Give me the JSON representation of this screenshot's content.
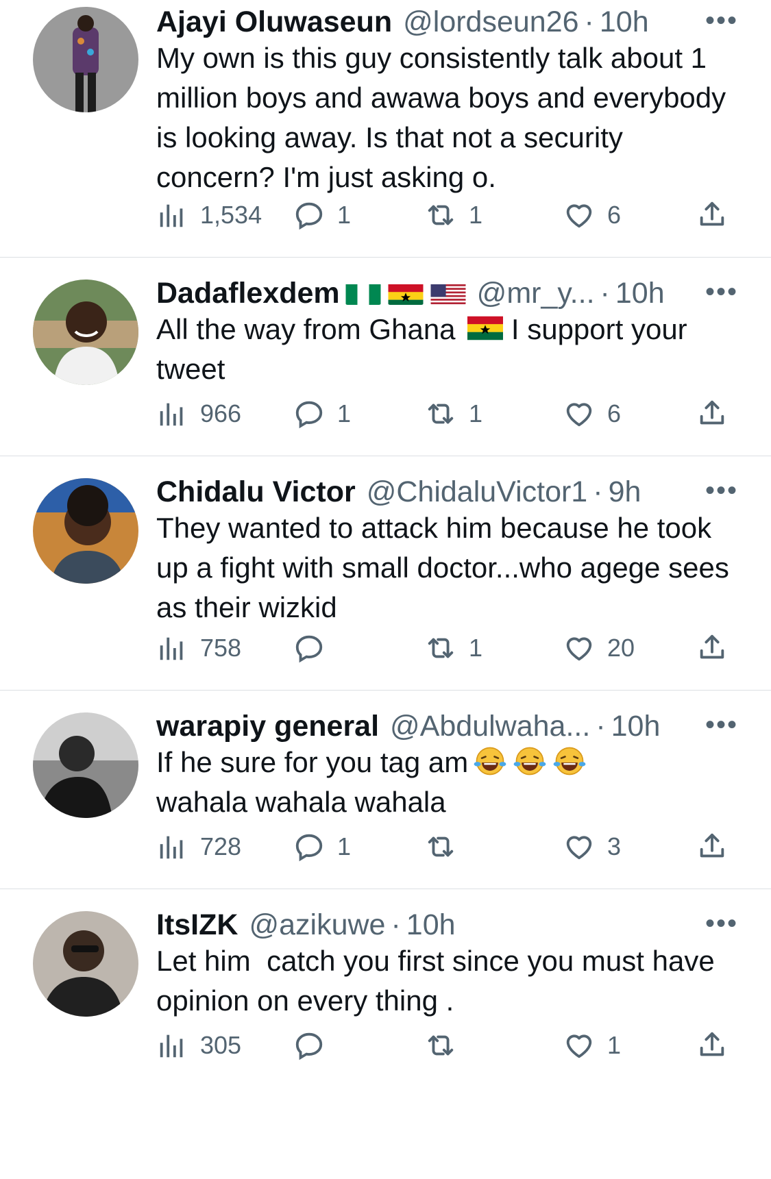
{
  "tweets": [
    {
      "name": "Ajayi Oluwaseun",
      "handle": "@lordseun26",
      "separator": "·",
      "time": "10h",
      "text": "My own is this guy consistently talk about 1 million boys and awawa boys and everybody is looking away. Is that not a security concern? I'm just asking o.",
      "views": "1,534",
      "replies": "1",
      "retweets": "1",
      "likes": "6"
    },
    {
      "name": "Dadaflexdem",
      "handle": "@mr_y...",
      "separator": "·",
      "time": "10h",
      "text_before_flag": "All the way from Ghana ",
      "text_after_flag": " I support your tweet",
      "views": "966",
      "replies": "1",
      "retweets": "1",
      "likes": "6"
    },
    {
      "name": "Chidalu Victor",
      "handle": "@ChidaluVictor1",
      "separator": "·",
      "time": "9h",
      "text": "They wanted to attack him because he took up a fight with small doctor...who agege sees as their wizkid",
      "views": "758",
      "replies": "",
      "retweets": "1",
      "likes": "20"
    },
    {
      "name": "warapiy general",
      "handle": "@Abdulwaha...",
      "separator": "·",
      "time": "10h",
      "text_line1": "If he sure for you tag am",
      "text_line2": "wahala wahala wahala",
      "views": "728",
      "replies": "1",
      "retweets": "",
      "likes": "3"
    },
    {
      "name": "ItsIZK",
      "handle": "@azikuwe",
      "separator": "·",
      "time": "10h",
      "text": "Let him  catch you first since you must have opinion on every thing .",
      "views": "305",
      "replies": "",
      "retweets": "",
      "likes": "1"
    }
  ],
  "more_label": "•••",
  "colors": {
    "text": "#0f1419",
    "secondary": "#536471",
    "divider": "#dcdfe3"
  },
  "icons": [
    "views-icon",
    "reply-icon",
    "retweet-icon",
    "like-icon",
    "share-icon",
    "more-icon"
  ]
}
